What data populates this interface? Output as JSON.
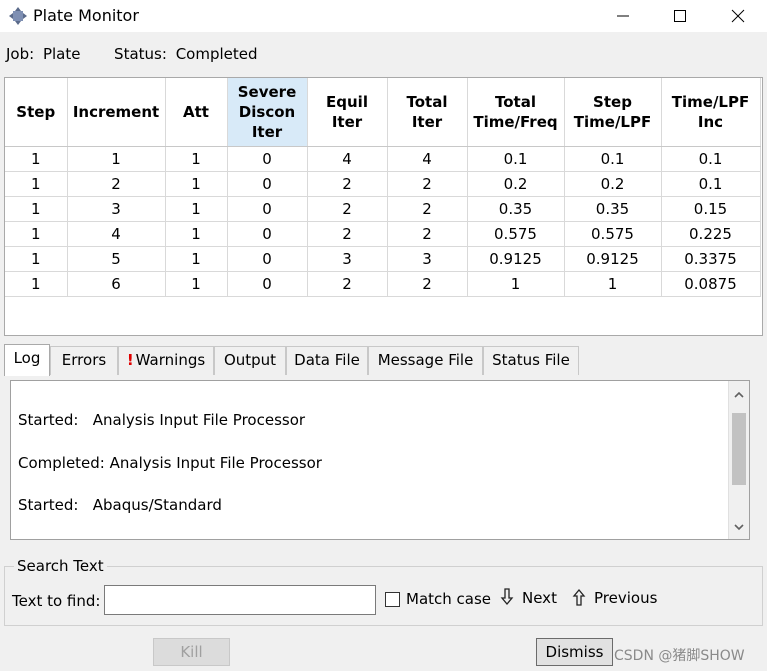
{
  "window": {
    "title": "Plate Monitor"
  },
  "job": {
    "job_label": "Job:",
    "job_name": "Plate",
    "status_label": "Status:",
    "status_value": "Completed"
  },
  "table": {
    "columns": [
      [
        "Step"
      ],
      [
        "Increment"
      ],
      [
        "Att"
      ],
      [
        "Severe",
        "Discon",
        "Iter"
      ],
      [
        "Equil",
        "Iter"
      ],
      [
        "Total",
        "Iter"
      ],
      [
        "Total",
        "Time/Freq"
      ],
      [
        "Step",
        "Time/LPF"
      ],
      [
        "Time/LPF",
        "Inc"
      ]
    ],
    "rows": [
      [
        "1",
        "1",
        "1",
        "0",
        "4",
        "4",
        "0.1",
        "0.1",
        "0.1"
      ],
      [
        "1",
        "2",
        "1",
        "0",
        "2",
        "2",
        "0.2",
        "0.2",
        "0.1"
      ],
      [
        "1",
        "3",
        "1",
        "0",
        "2",
        "2",
        "0.35",
        "0.35",
        "0.15"
      ],
      [
        "1",
        "4",
        "1",
        "0",
        "2",
        "2",
        "0.575",
        "0.575",
        "0.225"
      ],
      [
        "1",
        "5",
        "1",
        "0",
        "3",
        "3",
        "0.9125",
        "0.9125",
        "0.3375"
      ],
      [
        "1",
        "6",
        "1",
        "0",
        "2",
        "2",
        "1",
        "1",
        "0.0875"
      ]
    ]
  },
  "tabs": {
    "log": "Log",
    "errors": "Errors",
    "warnings_mark": "!",
    "warnings": "Warnings",
    "output": "Output",
    "data_file": "Data File",
    "message_file": "Message File",
    "status_file": "Status File"
  },
  "log": {
    "lines": [
      "Started:   Analysis Input File Processor",
      "Completed: Analysis Input File Processor",
      "Started:   Abaqus/Standard"
    ]
  },
  "search": {
    "legend": "Search Text",
    "find_label": "Text to find:",
    "find_value": "",
    "match_case": "Match case",
    "next": "Next",
    "previous": "Previous"
  },
  "buttons": {
    "kill": "Kill",
    "dismiss": "Dismiss"
  },
  "watermark": "CSDN @猪脚SHOW"
}
